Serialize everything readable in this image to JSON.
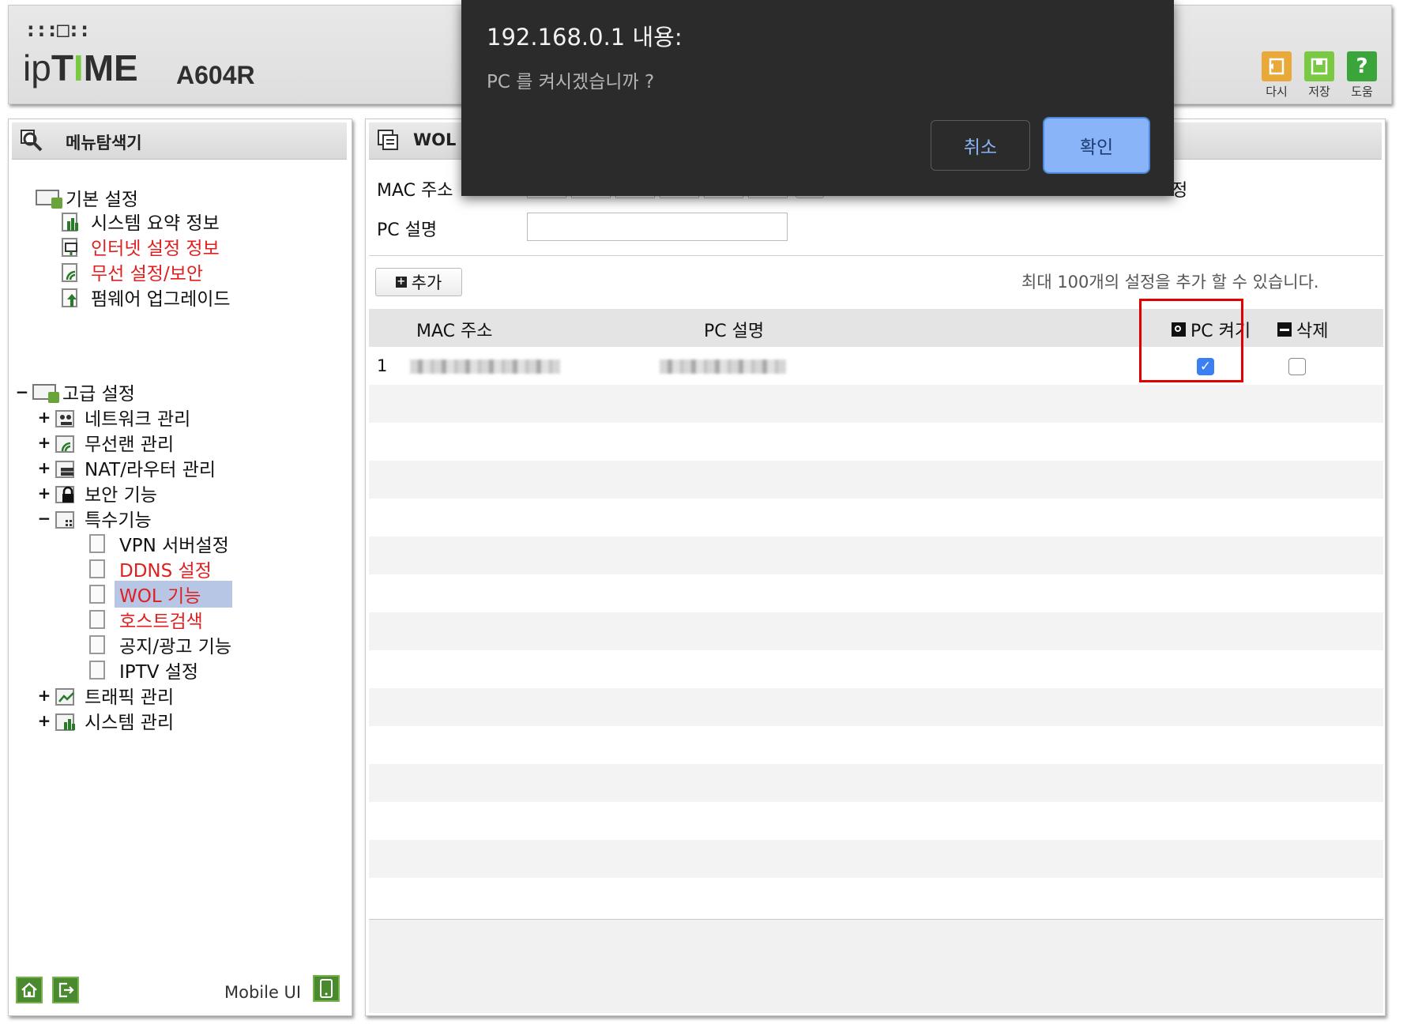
{
  "header": {
    "brand_top": ":::□::",
    "brand_prefix": "ip",
    "brand_t": "T",
    "brand_i": "I",
    "brand_me": "ME",
    "model": "A604R",
    "toolbar": [
      {
        "label": "다시",
        "icon": "refresh-icon",
        "color": "#e8a83a"
      },
      {
        "label": "저장",
        "icon": "save-icon",
        "color": "#7ac943"
      },
      {
        "label": "도움",
        "icon": "help-icon",
        "color": "#3aa53a",
        "glyph": "?"
      }
    ]
  },
  "sidebar": {
    "title": "메뉴탐색기",
    "basic": {
      "label": "기본 설정",
      "items": [
        {
          "label": "시스템 요약 정보",
          "highlight": false
        },
        {
          "label": "인터넷 설정 정보",
          "highlight": true
        },
        {
          "label": "무선 설정/보안",
          "highlight": true
        },
        {
          "label": "펌웨어 업그레이드",
          "highlight": false
        }
      ]
    },
    "advanced": {
      "expander": "−",
      "label": "고급 설정",
      "items": [
        {
          "expander": "+",
          "label": "네트워크 관리"
        },
        {
          "expander": "+",
          "label": "무선랜 관리"
        },
        {
          "expander": "+",
          "label": "NAT/라우터 관리"
        },
        {
          "expander": "+",
          "label": "보안 기능"
        },
        {
          "expander": "−",
          "label": "특수기능"
        }
      ],
      "special_children": [
        {
          "label": "VPN 서버설정",
          "highlight": false
        },
        {
          "label": "DDNS 설정",
          "highlight": true
        },
        {
          "label": "WOL 기능",
          "highlight": true,
          "selected": true
        },
        {
          "label": "호스트검색",
          "highlight": true
        },
        {
          "label": "공지/광고 기능",
          "highlight": false
        },
        {
          "label": "IPTV 설정",
          "highlight": false
        }
      ],
      "tail_items": [
        {
          "expander": "+",
          "label": "트래픽 관리"
        },
        {
          "expander": "+",
          "label": "시스템 관리"
        }
      ]
    },
    "mobile_label": "Mobile UI"
  },
  "main": {
    "title": "WOL",
    "title_tail": "정",
    "mac_label": "MAC 주소",
    "desc_label": "PC 설명",
    "add_label": "추가",
    "info_text": "최대 100개의 설정을 추가 할 수 있습니다.",
    "table": {
      "headers": {
        "mac": "MAC 주소",
        "desc": "PC 설명",
        "power": "PC 켜기",
        "delete": "삭제"
      },
      "rows": [
        {
          "index": "1",
          "power_checked": true,
          "delete_checked": false
        }
      ]
    }
  },
  "dialog": {
    "title": "192.168.0.1 내용:",
    "message": "PC 를 켜시겠습니까 ?",
    "cancel": "취소",
    "ok": "확인"
  }
}
